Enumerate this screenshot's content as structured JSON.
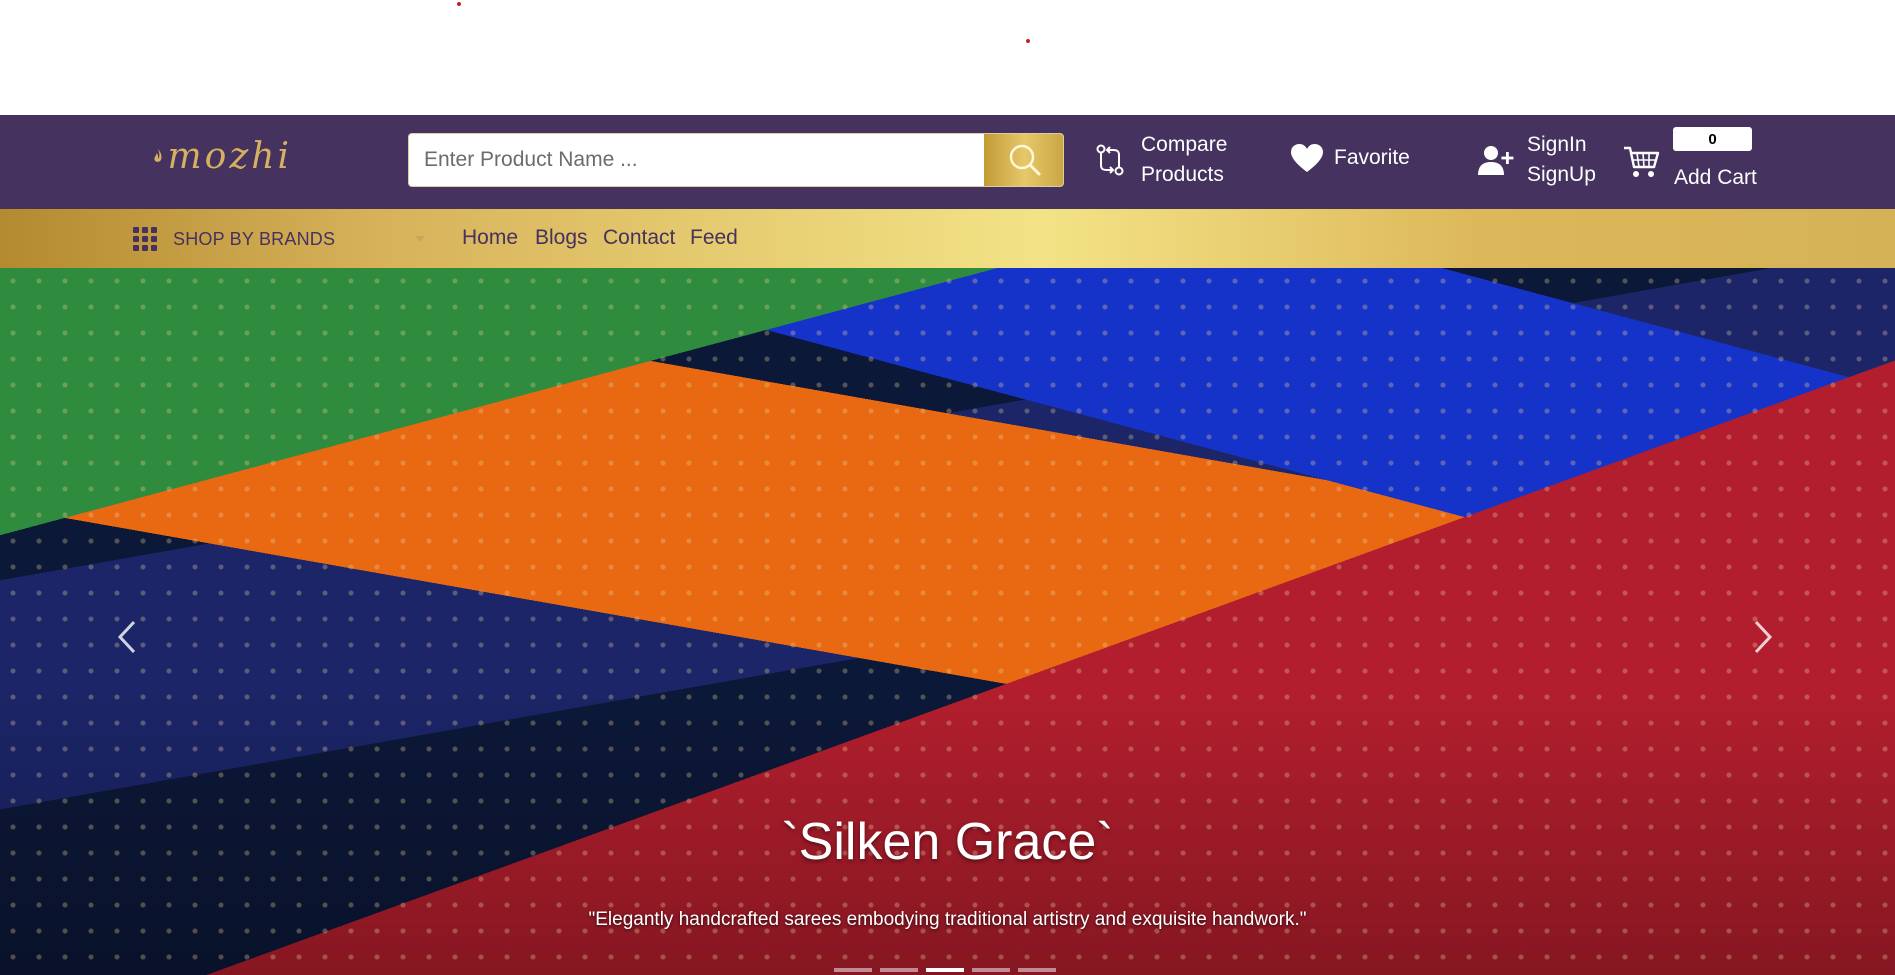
{
  "header": {
    "logo_text": "mozhi",
    "search": {
      "placeholder": "Enter Product Name ..."
    },
    "compare": {
      "line1": "Compare",
      "line2": "Products"
    },
    "favorite_label": "Favorite",
    "account": {
      "signin": "SignIn",
      "signup": "SignUp"
    },
    "cart": {
      "count": "0",
      "label": "Add Cart"
    }
  },
  "nav": {
    "brands_label": "SHOP BY BRANDS",
    "links": [
      "Home",
      "Blogs",
      "Contact",
      "Feed"
    ]
  },
  "hero": {
    "title": "`Silken Grace`",
    "subtitle": "\"Elegantly handcrafted sarees embodying traditional artistry and exquisite handwork.\"",
    "slide_count": 5,
    "active_slide": 3
  },
  "colors": {
    "header_bg": "#45325f",
    "gold": "#d6b257",
    "nav_text": "#45325f"
  }
}
